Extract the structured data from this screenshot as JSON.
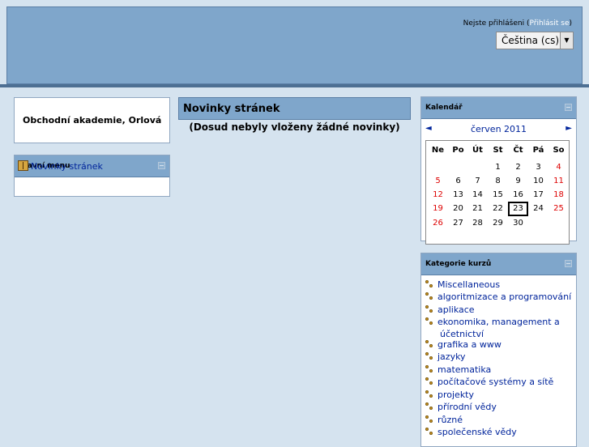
{
  "login": {
    "text": "Nejste přihlášeni (",
    "link": "Přihlásit se",
    "close": ")"
  },
  "language": {
    "selected": "Čeština (cs)"
  },
  "site_block": {
    "name": "Obchodní akademie, Orlová"
  },
  "main_menu": {
    "title": "Hlavní menu",
    "items": [
      {
        "label": "Novinky stránek",
        "icon": "news-icon"
      }
    ]
  },
  "news": {
    "title": "Novinky stránek",
    "empty_message": "(Dosud nebyly vloženy žádné novinky)"
  },
  "calendar": {
    "title": "Kalendář",
    "prev": "◄",
    "next": "►",
    "month": "červen 2011",
    "days_of_week": [
      "Ne",
      "Po",
      "Út",
      "St",
      "Čt",
      "Pá",
      "So"
    ],
    "weeks": [
      [
        "",
        "",
        "",
        "1",
        "2",
        "3",
        "4"
      ],
      [
        "5",
        "6",
        "7",
        "8",
        "9",
        "10",
        "11"
      ],
      [
        "12",
        "13",
        "14",
        "15",
        "16",
        "17",
        "18"
      ],
      [
        "19",
        "20",
        "21",
        "22",
        "23",
        "24",
        "25"
      ],
      [
        "26",
        "27",
        "28",
        "29",
        "30",
        "",
        ""
      ]
    ],
    "today": "23",
    "weekend_color": "#dd0000"
  },
  "categories": {
    "title": "Kategorie kurzů",
    "items": [
      "Miscellaneous",
      "algoritmizace a programování",
      "aplikace",
      "ekonomika, management a",
      "účetnictví",
      "grafika a www",
      "jazyky",
      "matematika",
      "počítačové systémy a sítě",
      "projekty",
      "přírodní vědy",
      "různé",
      "společenské vědy"
    ]
  },
  "colors": {
    "header": "#7fa6cb",
    "background": "#d5e3ef",
    "link": "#00249b"
  }
}
